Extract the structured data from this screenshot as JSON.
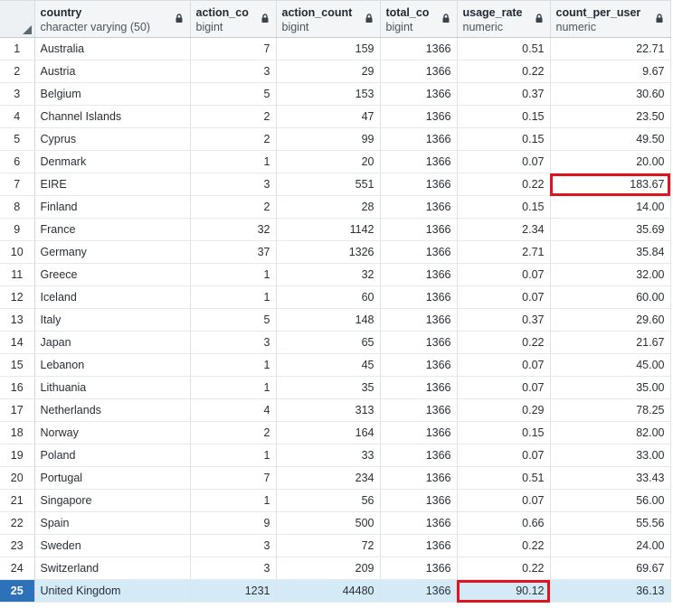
{
  "columns": [
    {
      "name": "country",
      "type": "character varying (50)",
      "align": "left"
    },
    {
      "name": "action_co",
      "type": "bigint",
      "align": "right"
    },
    {
      "name": "action_count",
      "type": "bigint",
      "align": "right"
    },
    {
      "name": "total_co",
      "type": "bigint",
      "align": "right"
    },
    {
      "name": "usage_rate",
      "type": "numeric",
      "align": "right"
    },
    {
      "name": "count_per_user",
      "type": "numeric",
      "align": "right"
    }
  ],
  "rows": [
    [
      "1",
      "Australia",
      "7",
      "159",
      "1366",
      "0.51",
      "22.71"
    ],
    [
      "2",
      "Austria",
      "3",
      "29",
      "1366",
      "0.22",
      "9.67"
    ],
    [
      "3",
      "Belgium",
      "5",
      "153",
      "1366",
      "0.37",
      "30.60"
    ],
    [
      "4",
      "Channel Islands",
      "2",
      "47",
      "1366",
      "0.15",
      "23.50"
    ],
    [
      "5",
      "Cyprus",
      "2",
      "99",
      "1366",
      "0.15",
      "49.50"
    ],
    [
      "6",
      "Denmark",
      "1",
      "20",
      "1366",
      "0.07",
      "20.00"
    ],
    [
      "7",
      "EIRE",
      "3",
      "551",
      "1366",
      "0.22",
      "183.67"
    ],
    [
      "8",
      "Finland",
      "2",
      "28",
      "1366",
      "0.15",
      "14.00"
    ],
    [
      "9",
      "France",
      "32",
      "1142",
      "1366",
      "2.34",
      "35.69"
    ],
    [
      "10",
      "Germany",
      "37",
      "1326",
      "1366",
      "2.71",
      "35.84"
    ],
    [
      "11",
      "Greece",
      "1",
      "32",
      "1366",
      "0.07",
      "32.00"
    ],
    [
      "12",
      "Iceland",
      "1",
      "60",
      "1366",
      "0.07",
      "60.00"
    ],
    [
      "13",
      "Italy",
      "5",
      "148",
      "1366",
      "0.37",
      "29.60"
    ],
    [
      "14",
      "Japan",
      "3",
      "65",
      "1366",
      "0.22",
      "21.67"
    ],
    [
      "15",
      "Lebanon",
      "1",
      "45",
      "1366",
      "0.07",
      "45.00"
    ],
    [
      "16",
      "Lithuania",
      "1",
      "35",
      "1366",
      "0.07",
      "35.00"
    ],
    [
      "17",
      "Netherlands",
      "4",
      "313",
      "1366",
      "0.29",
      "78.25"
    ],
    [
      "18",
      "Norway",
      "2",
      "164",
      "1366",
      "0.15",
      "82.00"
    ],
    [
      "19",
      "Poland",
      "1",
      "33",
      "1366",
      "0.07",
      "33.00"
    ],
    [
      "20",
      "Portugal",
      "7",
      "234",
      "1366",
      "0.51",
      "33.43"
    ],
    [
      "21",
      "Singapore",
      "1",
      "56",
      "1366",
      "0.07",
      "56.00"
    ],
    [
      "22",
      "Spain",
      "9",
      "500",
      "1366",
      "0.66",
      "55.56"
    ],
    [
      "23",
      "Sweden",
      "3",
      "72",
      "1366",
      "0.22",
      "24.00"
    ],
    [
      "24",
      "Switzerland",
      "3",
      "209",
      "1366",
      "0.22",
      "69.67"
    ],
    [
      "25",
      "United Kingdom",
      "1231",
      "44480",
      "1366",
      "90.12",
      "36.13"
    ]
  ],
  "selected_row": 24,
  "highlighted_cells": [
    {
      "row": 6,
      "col": 6
    },
    {
      "row": 24,
      "col": 5
    }
  ],
  "icons": {
    "column_lock": "lock-icon",
    "select_all": "select-all-corner-icon"
  },
  "colors": {
    "highlight_border": "#e0141e",
    "selected_row_bg": "#d5eaf7",
    "selected_index_bg": "#2d72b8"
  }
}
